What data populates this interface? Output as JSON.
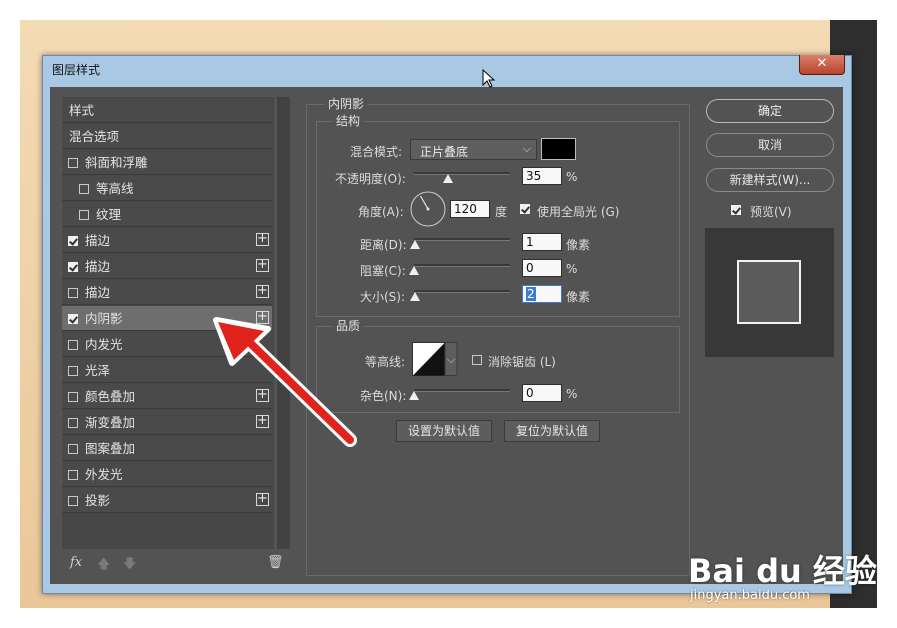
{
  "dialog": {
    "title": "图层样式",
    "close": "✕"
  },
  "left_panel": {
    "items": [
      {
        "label": "样式",
        "checkbox": null,
        "plus": false,
        "indent": false
      },
      {
        "label": "混合选项",
        "checkbox": null,
        "plus": false,
        "indent": false
      },
      {
        "label": "斜面和浮雕",
        "checkbox": false,
        "plus": false,
        "indent": false
      },
      {
        "label": "等高线",
        "checkbox": false,
        "plus": false,
        "indent": true
      },
      {
        "label": "纹理",
        "checkbox": false,
        "plus": false,
        "indent": true
      },
      {
        "label": "描边",
        "checkbox": true,
        "plus": true,
        "indent": false
      },
      {
        "label": "描边",
        "checkbox": true,
        "plus": true,
        "indent": false
      },
      {
        "label": "描边",
        "checkbox": false,
        "plus": true,
        "indent": false
      },
      {
        "label": "内阴影",
        "checkbox": true,
        "plus": true,
        "indent": false,
        "selected": true
      },
      {
        "label": "内发光",
        "checkbox": false,
        "plus": false,
        "indent": false
      },
      {
        "label": "光泽",
        "checkbox": false,
        "plus": false,
        "indent": false
      },
      {
        "label": "颜色叠加",
        "checkbox": false,
        "plus": true,
        "indent": false
      },
      {
        "label": "渐变叠加",
        "checkbox": false,
        "plus": true,
        "indent": false
      },
      {
        "label": "图案叠加",
        "checkbox": false,
        "plus": false,
        "indent": false
      },
      {
        "label": "外发光",
        "checkbox": false,
        "plus": false,
        "indent": false
      },
      {
        "label": "投影",
        "checkbox": false,
        "plus": true,
        "indent": false
      }
    ],
    "tools": {
      "fx": "fx",
      "up": "🡅",
      "down": "🡇",
      "trash": "🗑"
    }
  },
  "inner_shadow": {
    "section_title": "内阴影",
    "structure": {
      "title": "结构",
      "blend_mode_label": "混合模式:",
      "blend_mode_value": "正片叠底",
      "shadow_color": "#000000",
      "opacity_label": "不透明度(O):",
      "opacity_value": "35",
      "opacity_unit": "%",
      "angle_label": "角度(A):",
      "angle_value": "120",
      "angle_unit": "度",
      "global_light_label": "使用全局光 (G)",
      "global_light_checked": true,
      "distance_label": "距离(D):",
      "distance_value": "1",
      "distance_unit": "像素",
      "choke_label": "阻塞(C):",
      "choke_value": "0",
      "choke_unit": "%",
      "size_label": "大小(S):",
      "size_value": "2",
      "size_unit": "像素"
    },
    "quality": {
      "title": "品质",
      "contour_label": "等高线:",
      "antialias_label": "消除锯齿 (L)",
      "antialias_checked": false,
      "noise_label": "杂色(N):",
      "noise_value": "0",
      "noise_unit": "%"
    },
    "make_default": "设置为默认值",
    "reset_default": "复位为默认值"
  },
  "right_panel": {
    "ok": "确定",
    "cancel": "取消",
    "new_style": "新建样式(W)...",
    "preview_label": "预览(V)",
    "preview_checked": true
  },
  "watermark": {
    "brand": "Bai du 经验",
    "url": "jingyan.baidu.com"
  },
  "colors": {
    "panel": "#535353",
    "accent_arrow": "#e0231c",
    "titlebar": "#a8c8e4"
  }
}
